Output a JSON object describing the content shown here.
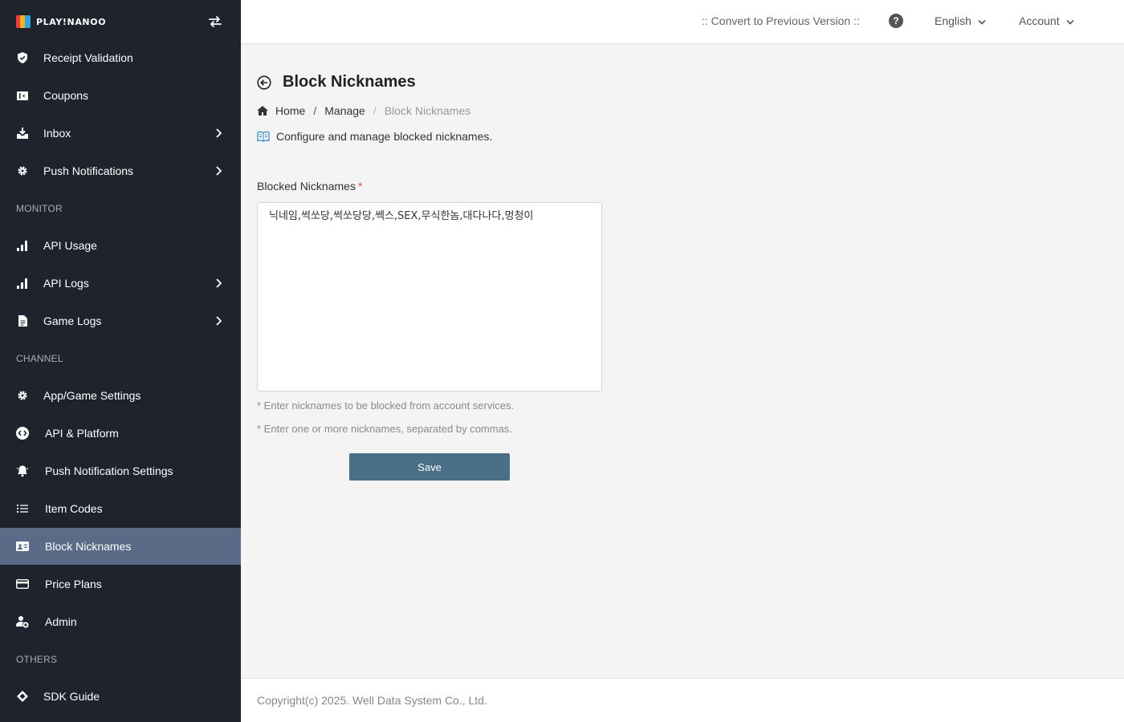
{
  "brand": {
    "logo_text": "PLAY!NANOO",
    "logo_colors": [
      "#e8413c",
      "#f7b322",
      "#2fa7e0"
    ]
  },
  "sidebar": {
    "items_top": [
      {
        "label": "Receipt Validation",
        "icon": "shield-check-icon",
        "has_submenu": false
      },
      {
        "label": "Coupons",
        "icon": "ticket-icon",
        "has_submenu": false
      },
      {
        "label": "Inbox",
        "icon": "inbox-icon",
        "has_submenu": true
      },
      {
        "label": "Push Notifications",
        "icon": "gear-icon",
        "has_submenu": true
      }
    ],
    "section_monitor": "MONITOR",
    "items_monitor": [
      {
        "label": "API Usage",
        "icon": "bar-chart-icon",
        "has_submenu": false
      },
      {
        "label": "API Logs",
        "icon": "bar-chart-icon",
        "has_submenu": true
      },
      {
        "label": "Game Logs",
        "icon": "document-icon",
        "has_submenu": true
      }
    ],
    "section_channel": "CHANNEL",
    "items_channel": [
      {
        "label": "App/Game Settings",
        "icon": "gear-icon",
        "has_submenu": false
      },
      {
        "label": "API & Platform",
        "icon": "code-circle-icon",
        "has_submenu": false
      },
      {
        "label": "Push Notification Settings",
        "icon": "bell-icon",
        "has_submenu": false
      },
      {
        "label": "Item Codes",
        "icon": "list-icon",
        "has_submenu": false
      },
      {
        "label": "Block Nicknames",
        "icon": "id-card-icon",
        "has_submenu": false,
        "active": true
      },
      {
        "label": "Price Plans",
        "icon": "credit-card-icon",
        "has_submenu": false
      },
      {
        "label": "Admin",
        "icon": "user-plus-icon",
        "has_submenu": false
      }
    ],
    "section_others": "OTHERS",
    "items_others": [
      {
        "label": "SDK Guide",
        "icon": "diamond-icon",
        "has_submenu": false
      }
    ]
  },
  "topbar": {
    "convert_label": ":: Convert to Previous Version ::",
    "help_label": "?",
    "language_label": "English",
    "account_label": "Account"
  },
  "page": {
    "title": "Block Nicknames",
    "breadcrumb": {
      "home": "Home",
      "sep1": "/",
      "manage": "Manage",
      "sep2": "/",
      "current": "Block Nicknames"
    },
    "description": "Configure and manage blocked nicknames."
  },
  "form": {
    "label": "Blocked Nicknames",
    "required_mark": "*",
    "value": "닉네임,썩쏘당,썩쏘당당,쎅스,SEX,무식한놈,대다나다,멍청이",
    "help_1": "* Enter nicknames to be blocked from account services.",
    "help_2": "* Enter one or more nicknames, separated by commas.",
    "save_label": "Save"
  },
  "footer": {
    "copyright": "Copyright(c) 2025. Well Data System Co., Ltd."
  },
  "colors": {
    "sidebar_bg": "#1e232e",
    "sidebar_active": "#5a6a87",
    "save_button": "#4a6f86",
    "required": "#e74c3c"
  }
}
